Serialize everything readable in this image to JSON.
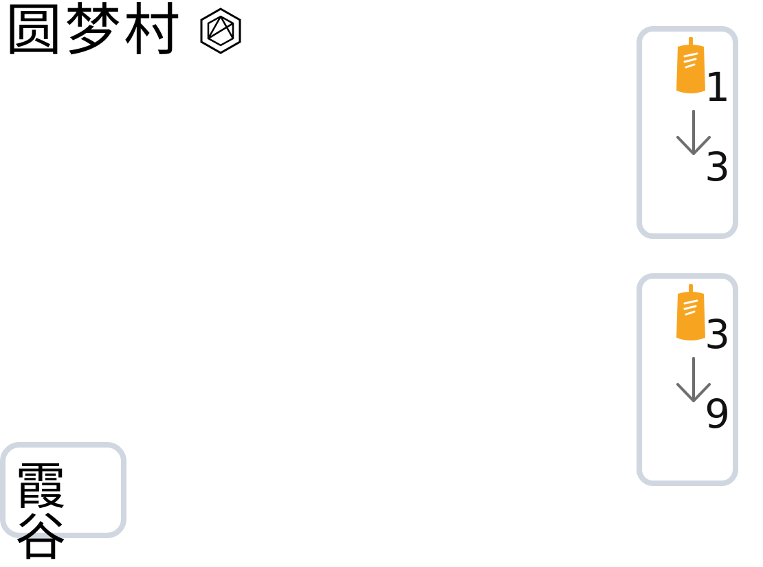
{
  "header": {
    "title": "圆梦村",
    "title_icon": "aperture-hexagon-icon"
  },
  "trades": [
    {
      "icon": "bottle-icon",
      "from_count": "1",
      "arrow_icon": "arrow-down-icon",
      "to_count": "3"
    },
    {
      "icon": "bottle-icon",
      "from_count": "3",
      "arrow_icon": "arrow-down-icon",
      "to_count": "9"
    }
  ],
  "location": {
    "label": "霞谷"
  },
  "colors": {
    "card_border": "#d0d7e0",
    "bottle": "#f7a521",
    "arrow": "#6e6e6e",
    "text": "#111111"
  }
}
